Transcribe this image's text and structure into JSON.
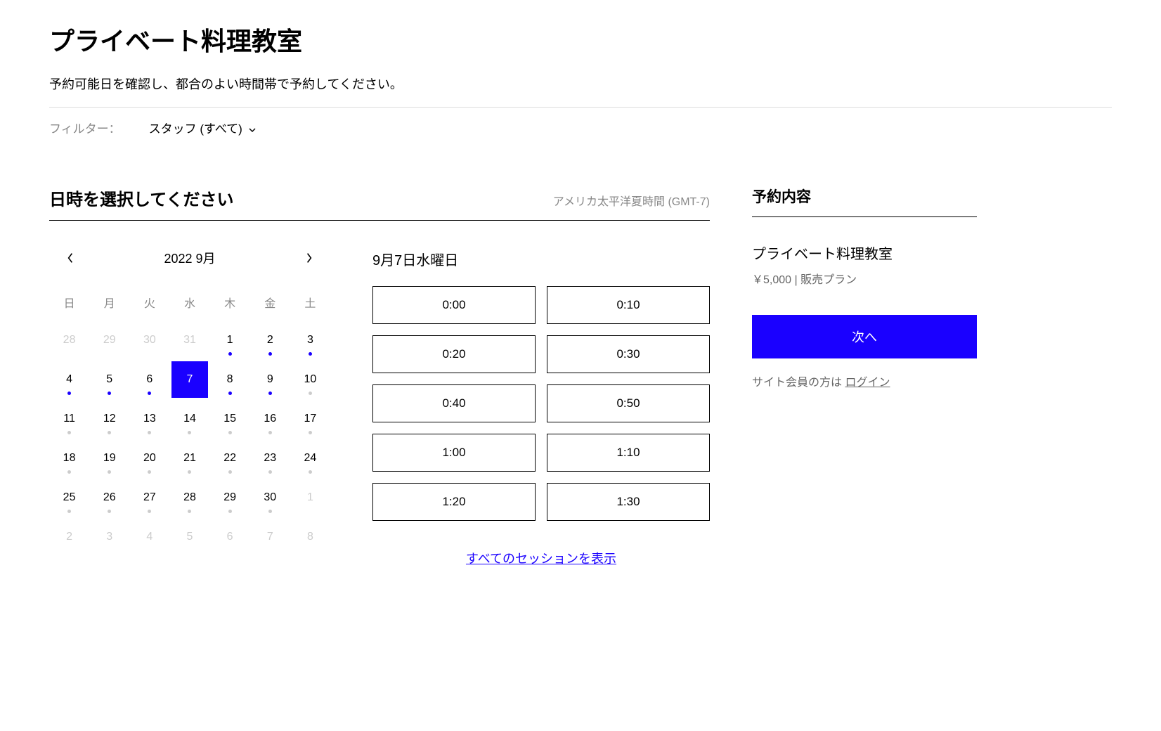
{
  "header": {
    "title": "プライベート料理教室",
    "subtitle": "予約可能日を確認し、都合のよい時間帯で予約してください。"
  },
  "filter": {
    "label": "フィルター：",
    "value": "スタッフ (すべて)"
  },
  "datetime": {
    "section_title": "日時を選択してください",
    "timezone": "アメリカ太平洋夏時間 (GMT-7)"
  },
  "calendar": {
    "month_label": "2022  9月",
    "dow": [
      "日",
      "月",
      "火",
      "水",
      "木",
      "金",
      "土"
    ],
    "days": [
      {
        "n": "28",
        "other": true
      },
      {
        "n": "29",
        "other": true
      },
      {
        "n": "30",
        "other": true
      },
      {
        "n": "31",
        "other": true
      },
      {
        "n": "1",
        "dot": "blue"
      },
      {
        "n": "2",
        "dot": "blue"
      },
      {
        "n": "3",
        "dot": "blue"
      },
      {
        "n": "4",
        "dot": "blue"
      },
      {
        "n": "5",
        "dot": "blue"
      },
      {
        "n": "6",
        "dot": "blue"
      },
      {
        "n": "7",
        "selected": true
      },
      {
        "n": "8",
        "dot": "blue"
      },
      {
        "n": "9",
        "dot": "blue"
      },
      {
        "n": "10",
        "dot": "grey"
      },
      {
        "n": "11",
        "dot": "grey"
      },
      {
        "n": "12",
        "dot": "grey"
      },
      {
        "n": "13",
        "dot": "grey"
      },
      {
        "n": "14",
        "dot": "grey"
      },
      {
        "n": "15",
        "dot": "grey"
      },
      {
        "n": "16",
        "dot": "grey"
      },
      {
        "n": "17",
        "dot": "grey"
      },
      {
        "n": "18",
        "dot": "grey"
      },
      {
        "n": "19",
        "dot": "grey"
      },
      {
        "n": "20",
        "dot": "grey"
      },
      {
        "n": "21",
        "dot": "grey"
      },
      {
        "n": "22",
        "dot": "grey"
      },
      {
        "n": "23",
        "dot": "grey"
      },
      {
        "n": "24",
        "dot": "grey"
      },
      {
        "n": "25",
        "dot": "grey"
      },
      {
        "n": "26",
        "dot": "grey"
      },
      {
        "n": "27",
        "dot": "grey"
      },
      {
        "n": "28",
        "dot": "grey"
      },
      {
        "n": "29",
        "dot": "grey"
      },
      {
        "n": "30",
        "dot": "grey"
      },
      {
        "n": "1",
        "other": true
      },
      {
        "n": "2",
        "other": true
      },
      {
        "n": "3",
        "other": true
      },
      {
        "n": "4",
        "other": true
      },
      {
        "n": "5",
        "other": true
      },
      {
        "n": "6",
        "other": true
      },
      {
        "n": "7",
        "other": true
      },
      {
        "n": "8",
        "other": true
      }
    ]
  },
  "slots": {
    "date_label": "9月7日水曜日",
    "times": [
      "0:00",
      "0:10",
      "0:20",
      "0:30",
      "0:40",
      "0:50",
      "1:00",
      "1:10",
      "1:20",
      "1:30"
    ],
    "show_all": "すべてのセッションを表示"
  },
  "summary": {
    "title": "予約内容",
    "service_name": "プライベート料理教室",
    "price_plan": "￥5,000 | 販売プラン",
    "next_button": "次へ",
    "login_prefix": "サイト会員の方は ",
    "login_link": "ログイン"
  }
}
